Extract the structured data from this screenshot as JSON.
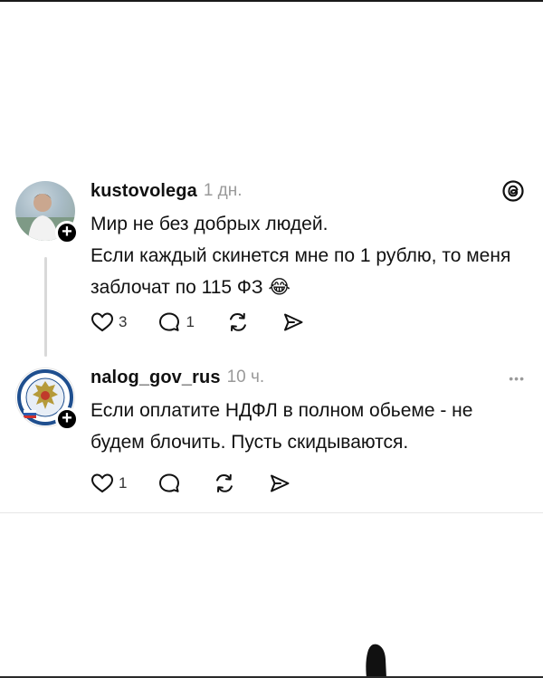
{
  "posts": [
    {
      "username": "kustovolega",
      "time": "1 дн.",
      "text_lines": [
        "Мир не без добрых людей.",
        "Если каждый скинется мне по 1 рублю, то меня заблочат по 115 ФЗ 😂"
      ],
      "likes": "3",
      "replies": "1",
      "corner_icon": "threads-icon"
    },
    {
      "username": "nalog_gov_rus",
      "time": "10 ч.",
      "text_lines": [
        "Если оплатите НДФЛ в полном обьеме - не будем блочить. Пусть скидываются."
      ],
      "likes": "1",
      "replies": "",
      "corner_icon": "more-icon"
    }
  ],
  "badge_symbol": "+",
  "more_symbol": "•••"
}
